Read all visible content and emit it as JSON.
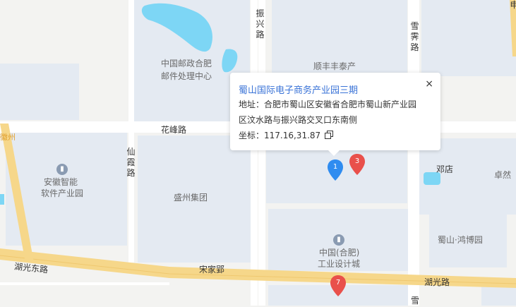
{
  "map": {
    "roads": {
      "zhenxing": "振兴路",
      "xuefei": "雪霁路",
      "huafeng": "花峰路",
      "xianxia": "仙霞路",
      "huguang_left": "湖光东路",
      "huguang_right": "湖光路",
      "songjiayan": "宋家郢",
      "xue_bottom": "雪"
    },
    "areas": {
      "post_line1": "中国邮政合肥",
      "post_line2": "邮件处理中心",
      "shunfeng": "顺丰丰泰产",
      "anhui_line1": "安徽智能",
      "anhui_line2": "软件产业园",
      "shengzhou": "盛州集团",
      "dengdian": "邓店",
      "zhuoran": "卓然",
      "hongbo": "蜀山·鸿博园",
      "design_line1": "中国(合肥)",
      "design_line2": "工业设计城",
      "left_edge": "徽州",
      "top_right": "申"
    },
    "markers": [
      {
        "label": "1",
        "color": "#2f8cf0"
      },
      {
        "label": "3",
        "color": "#e9504b"
      },
      {
        "label": "7",
        "color": "#e9504b"
      }
    ]
  },
  "popup": {
    "title": "蜀山国际电子商务产业园三期",
    "address_line1": "地址：合肥市蜀山区安徽省合肥市蜀山新产业园",
    "address_line2": "区汶水路与振兴路交叉口东南侧",
    "coords": "坐标：117.16,31.87",
    "close": "×"
  }
}
